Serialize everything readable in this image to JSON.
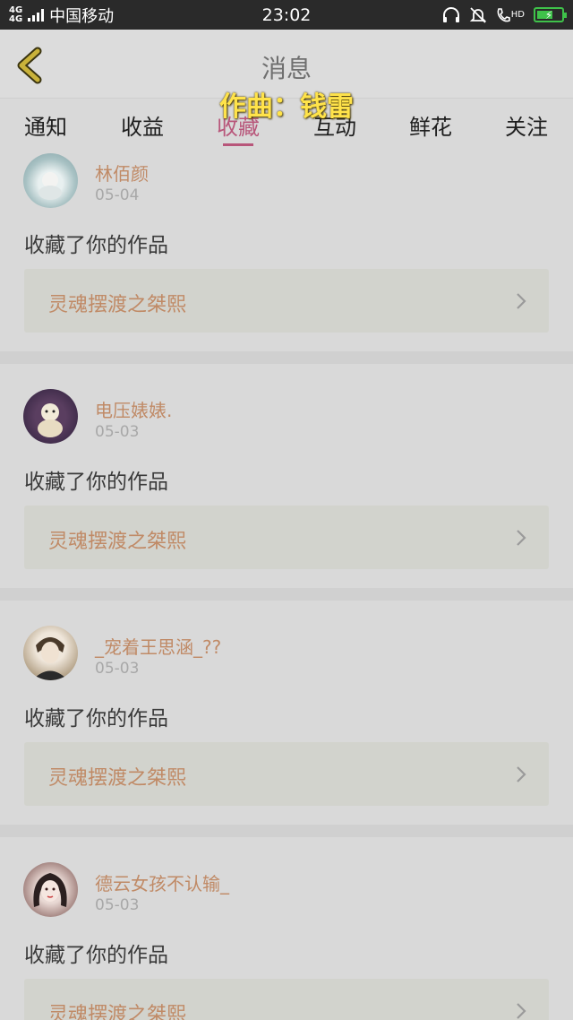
{
  "status_bar": {
    "network_top": "4G",
    "network_bottom": "4G",
    "carrier": "中国移动",
    "time": "23:02",
    "hd": "HD"
  },
  "header": {
    "title": "消息",
    "caption": "作曲：钱雷"
  },
  "tabs": [
    {
      "label": "通知"
    },
    {
      "label": "收益"
    },
    {
      "label": "收藏",
      "active": true
    },
    {
      "label": "互动"
    },
    {
      "label": "鲜花"
    },
    {
      "label": "关注"
    }
  ],
  "items": [
    {
      "username": "林佰颜",
      "date": "05-04",
      "action": "收藏了你的作品",
      "work": "灵魂摆渡之桀熙",
      "avatar": "avatar-photo-icon"
    },
    {
      "username": "电压婊婊.",
      "date": "05-03",
      "action": "收藏了你的作品",
      "work": "灵魂摆渡之桀熙",
      "avatar": "avatar-photo-icon"
    },
    {
      "username": "_宠着王思涵_??",
      "date": "05-03",
      "action": "收藏了你的作品",
      "work": "灵魂摆渡之桀熙",
      "avatar": "avatar-photo-icon"
    },
    {
      "username": "德云女孩不认输_",
      "date": "05-03",
      "action": "收藏了你的作品",
      "work": "灵魂摆渡之桀熙",
      "avatar": "avatar-photo-icon"
    }
  ],
  "colors": {
    "accent": "#b8567a",
    "username": "#c08a66",
    "caption": "#ffe34a",
    "back_arrow": "#c9b23a"
  }
}
